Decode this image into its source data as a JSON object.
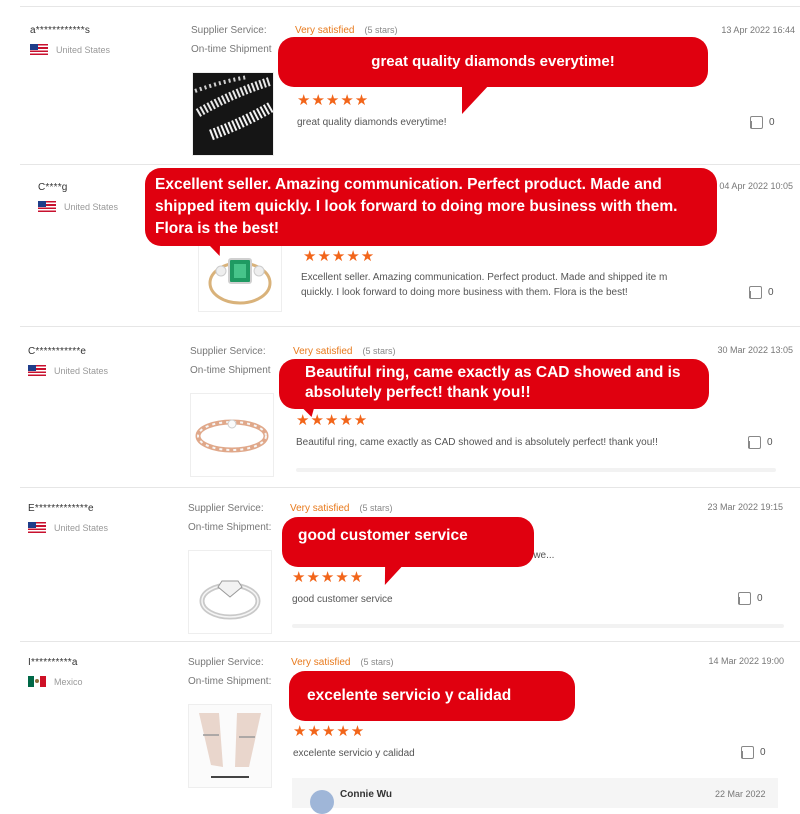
{
  "colors": {
    "accent": "#e0000f",
    "star": "#f2651a",
    "rating_text": "#e87a1d"
  },
  "reviews": [
    {
      "user": "a************s",
      "country": "United States",
      "flag": "us-flag",
      "supplier_label": "Supplier Service:",
      "rating_label": "Very satisfied",
      "rating_stars": "(5 stars)",
      "shipment_label": "On-time Shipment",
      "date": "13 Apr 2022 16:44",
      "stars": "★★★★★",
      "stars_value": 5,
      "text": "great quality diamonds everytime!",
      "likes": "0",
      "bubble": "great quality diamonds everytime!"
    },
    {
      "user": "C****g",
      "country": "United States",
      "flag": "us-flag",
      "date": "04 Apr 2022 10:05",
      "stars": "★★★★★",
      "stars_value": 5,
      "text": "Excellent seller. Amazing communication. Perfect product. Made and shipped ite m quickly. I look forward to doing more business with them. Flora is the best!",
      "likes": "0",
      "bubble": "Excellent seller. Amazing communication. Perfect product. Made and shipped item quickly. I look forward to doing more business with them. Flora is the best!"
    },
    {
      "user": "C***********e",
      "country": "United States",
      "flag": "us-flag",
      "supplier_label": "Supplier Service:",
      "rating_label": "Very satisfied",
      "rating_stars": "(5 stars)",
      "shipment_label": "On-time Shipment",
      "date": "30 Mar 2022 13:05",
      "stars": "★★★★★",
      "stars_value": 5,
      "text": "Beautiful ring, came exactly as CAD showed and is absolutely perfect! thank you!!",
      "likes": "0",
      "bubble": "Beautiful ring, came exactly as CAD showed and is absolutely perfect! thank you!!"
    },
    {
      "user": "E*************e",
      "country": "United States",
      "flag": "us-flag",
      "supplier_label": "Supplier Service:",
      "rating_label": "Very satisfied",
      "rating_stars": "(5 stars)",
      "shipment_label": "On-time Shipment:",
      "partial_text": "d we...",
      "date": "23 Mar 2022 19:15",
      "stars": "★★★★★",
      "stars_value": 5,
      "text": "good customer service",
      "likes": "0",
      "bubble": "good customer service"
    },
    {
      "user": "I**********a",
      "country": "Mexico",
      "flag": "mexico-flag",
      "supplier_label": "Supplier Service:",
      "rating_label": "Very satisfied",
      "rating_stars": "(5 stars)",
      "shipment_label": "On-time Shipment:",
      "date": "14 Mar 2022 19:00",
      "stars": "★★★★★",
      "stars_value": 5,
      "text": "excelente servicio y calidad",
      "likes": "0",
      "bubble": "excelente servicio y calidad"
    }
  ],
  "reply": {
    "name": "Connie Wu",
    "date": "22 Mar 2022"
  }
}
